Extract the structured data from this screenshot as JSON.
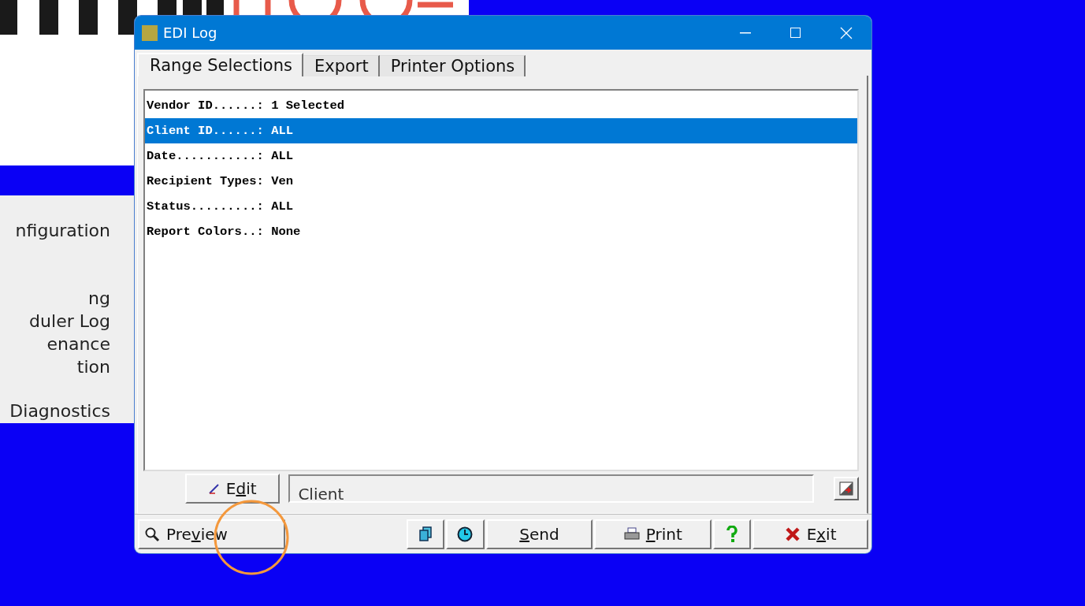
{
  "menu_panel": {
    "items": [
      "nfiguration",
      "ng",
      "duler Log",
      "enance",
      "tion",
      "Diagnostics"
    ]
  },
  "window": {
    "title": "EDI Log"
  },
  "tabs": [
    {
      "label": "Range Selections",
      "selected": true
    },
    {
      "label": "Export",
      "selected": false
    },
    {
      "label": "Printer Options",
      "selected": false
    }
  ],
  "list": [
    {
      "label": "Vendor ID......:",
      "value": "1 Selected",
      "selected": false
    },
    {
      "label": "Client ID......:",
      "value": "ALL",
      "selected": true
    },
    {
      "label": "Date...........:",
      "value": "ALL",
      "selected": false
    },
    {
      "label": "Recipient Types:",
      "value": "Ven",
      "selected": false
    },
    {
      "label": "Status.........:",
      "value": "ALL",
      "selected": false
    },
    {
      "label": "Report Colors..:",
      "value": "None",
      "selected": false
    }
  ],
  "edit_button": {
    "before": "E",
    "key": "d",
    "after": "it"
  },
  "detail_field": {
    "value": "Client"
  },
  "bottom_buttons": [
    {
      "kind": "text",
      "before": "Pre",
      "key": "v",
      "after": "iew"
    },
    {
      "kind": "icon"
    },
    {
      "kind": "icon"
    },
    {
      "kind": "text",
      "key": "S",
      "after": "end"
    },
    {
      "kind": "text",
      "key": "P",
      "after": "rint"
    },
    {
      "kind": "icon"
    },
    {
      "kind": "text",
      "before": "E",
      "key": "x",
      "after": "it"
    }
  ]
}
